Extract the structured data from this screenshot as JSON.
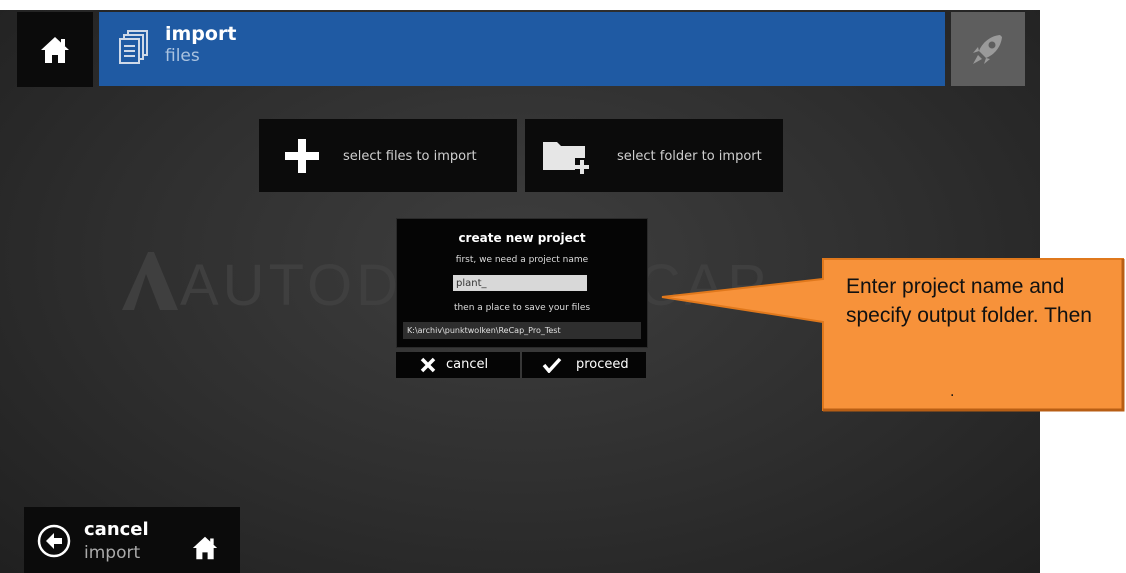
{
  "header": {
    "title": "import",
    "subtitle": "files"
  },
  "actions": {
    "select_files": "select files to import",
    "select_folder": "select folder to import"
  },
  "watermark": "AUTODESK RECAP",
  "dialog": {
    "title": "create new project",
    "name_prompt": "first, we need a project name",
    "name_value": "plant_",
    "location_prompt": "then a place to save your files",
    "path_value": "K:\\archiv\\punktwolken\\ReCap_Pro_Test",
    "cancel_label": "cancel",
    "proceed_label": "proceed"
  },
  "footer": {
    "cancel_title": "cancel",
    "cancel_sub": "import"
  },
  "callout": {
    "text": "Enter project name and specify output folder. Then",
    "trailing": "."
  },
  "icons": [
    "home-icon",
    "files-icon",
    "rocket-icon",
    "plus-icon",
    "folder-add-icon",
    "close-icon",
    "check-icon",
    "back-arrow-icon"
  ],
  "colors": {
    "header_blue": "#1f5aa3",
    "callout_orange": "#f7923a",
    "callout_border": "#e0781c",
    "tile_black": "#0b0b0b"
  }
}
